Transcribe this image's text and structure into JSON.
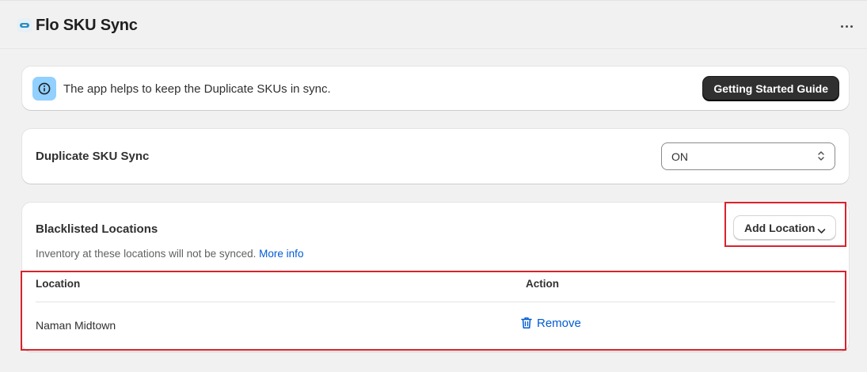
{
  "app": {
    "title": "Flo SKU Sync",
    "icon": "app-logo-icon",
    "more_icon": "ellipsis-icon"
  },
  "banner": {
    "icon": "info-icon",
    "text": "The app helps to keep the Duplicate SKUs in sync.",
    "button_label": "Getting Started Guide"
  },
  "sync": {
    "label": "Duplicate SKU Sync",
    "selected_value": "ON",
    "select_icon": "select-arrows-icon"
  },
  "blacklist": {
    "title": "Blacklisted Locations",
    "description": "Inventory at these locations will not be synced.",
    "more_info_link": "More info",
    "add_button_label": "Add Location",
    "add_button_icon": "chevron-down-icon",
    "table": {
      "columns": [
        "Location",
        "Action"
      ],
      "rows": [
        {
          "location": "Naman Midtown",
          "action_label": "Remove",
          "action_icon": "trash-icon"
        }
      ]
    }
  },
  "colors": {
    "page_bg": "#f1f1f1",
    "card_bg": "#ffffff",
    "primary_button": "#303030",
    "link": "#005bd3",
    "info_badge": "#91d0ff",
    "highlight": "#d9222b"
  }
}
